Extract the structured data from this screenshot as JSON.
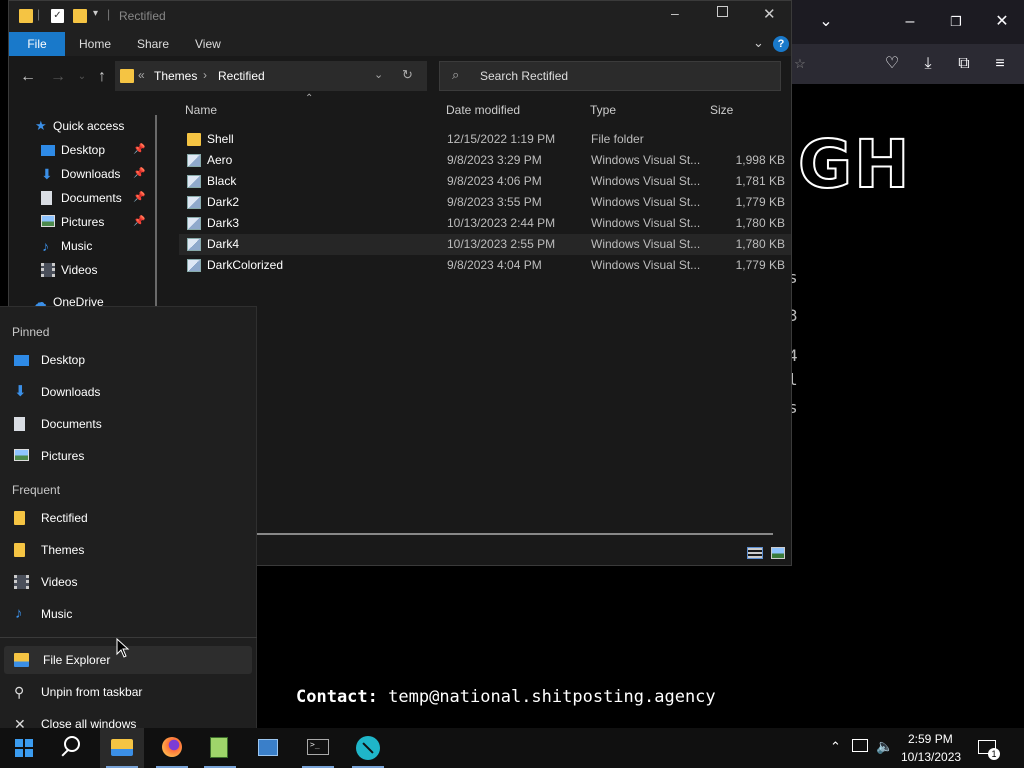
{
  "explorer": {
    "title": "Rectified",
    "ribbon_tabs": [
      "File",
      "Home",
      "Share",
      "View"
    ],
    "breadcrumb": [
      "Themes",
      "Rectified"
    ],
    "search_placeholder": "Search Rectified",
    "columns": {
      "name": "Name",
      "date": "Date modified",
      "type": "Type",
      "size": "Size"
    },
    "files": [
      {
        "name": "Shell",
        "date": "12/15/2022 1:19 PM",
        "type": "File folder",
        "size": "",
        "icon": "folder-icon"
      },
      {
        "name": "Aero",
        "date": "9/8/2023 3:29 PM",
        "type": "Windows Visual St...",
        "size": "1,998 KB",
        "icon": "theme-file-icon"
      },
      {
        "name": "Black",
        "date": "9/8/2023 4:06 PM",
        "type": "Windows Visual St...",
        "size": "1,781 KB",
        "icon": "theme-file-icon"
      },
      {
        "name": "Dark2",
        "date": "9/8/2023 3:55 PM",
        "type": "Windows Visual St...",
        "size": "1,779 KB",
        "icon": "theme-file-icon"
      },
      {
        "name": "Dark3",
        "date": "10/13/2023 2:44 PM",
        "type": "Windows Visual St...",
        "size": "1,780 KB",
        "icon": "theme-file-icon"
      },
      {
        "name": "Dark4",
        "date": "10/13/2023 2:55 PM",
        "type": "Windows Visual St...",
        "size": "1,780 KB",
        "icon": "theme-file-icon"
      },
      {
        "name": "DarkColorized",
        "date": "9/8/2023 4:04 PM",
        "type": "Windows Visual St...",
        "size": "1,779 KB",
        "icon": "theme-file-icon"
      }
    ],
    "nav": {
      "quick_access": "Quick access",
      "items": [
        "Desktop",
        "Downloads",
        "Documents",
        "Pictures",
        "Music",
        "Videos"
      ],
      "onedrive": "OneDrive"
    }
  },
  "jumplist": {
    "pinned_header": "Pinned",
    "pinned": [
      "Desktop",
      "Downloads",
      "Documents",
      "Pictures"
    ],
    "frequent_header": "Frequent",
    "frequent": [
      "Rectified",
      "Themes",
      "Videos",
      "Music"
    ],
    "actions": [
      "File Explorer",
      "Unpin from taskbar",
      "Close all windows"
    ]
  },
  "background": {
    "contact_label": "Contact:",
    "contact_value": "temp@national.shitposting.agency",
    "big_text": "GH"
  },
  "taskbar": {
    "time": "2:59 PM",
    "date": "10/13/2023",
    "notification_count": "1"
  },
  "colors": {
    "accent": "#1979ca",
    "folder": "#f5c443"
  }
}
